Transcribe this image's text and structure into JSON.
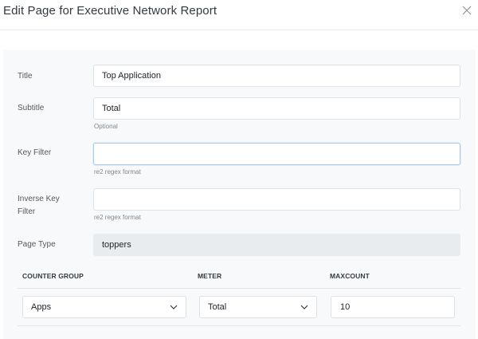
{
  "modal": {
    "title": "Edit Page for Executive Network Report",
    "close_icon": "close-icon"
  },
  "form": {
    "title": {
      "label": "Title",
      "value": "Top Application"
    },
    "subtitle": {
      "label": "Subtitle",
      "value": "Total",
      "hint": "Optional"
    },
    "key_filter": {
      "label": "Key Filter",
      "value": "",
      "hint": "re2 regex format"
    },
    "inverse_key_filter": {
      "label_line1": "Inverse Key",
      "label_line2": "Filter",
      "value": "",
      "hint": "re2 regex format"
    },
    "page_type": {
      "label": "Page Type",
      "value": "toppers"
    }
  },
  "table": {
    "headers": [
      "COUNTER GROUP",
      "METER",
      "MAXCOUNT"
    ],
    "row": {
      "counter_group": "Apps",
      "meter": "Total",
      "maxcount": "10"
    },
    "chevron_icon": "chevron-down-icon"
  }
}
